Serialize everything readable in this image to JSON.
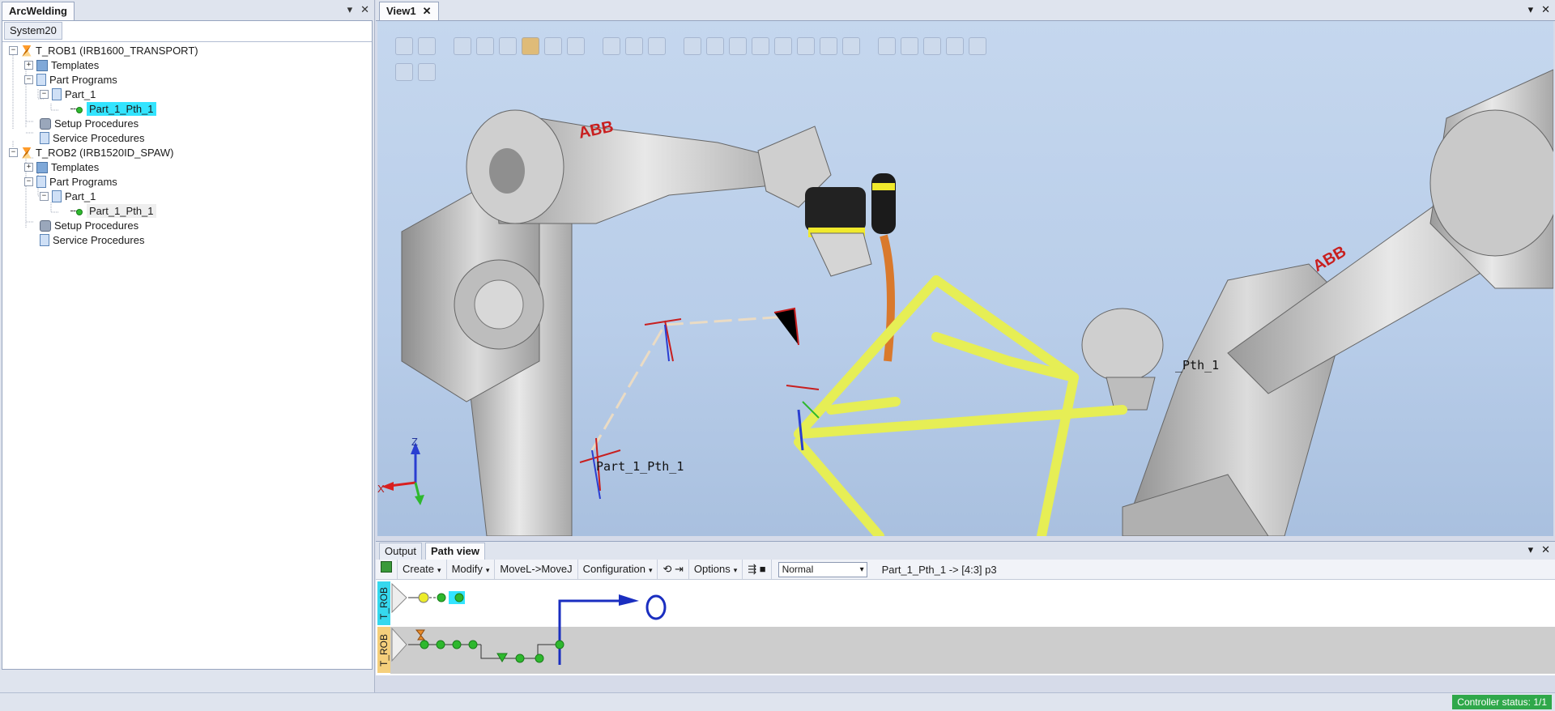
{
  "left_panel": {
    "tab_label": "ArcWelding",
    "sub_tab": "System20",
    "tree": {
      "rob1": "T_ROB1 (IRB1600_TRANSPORT)",
      "rob1_templates": "Templates",
      "rob1_part_programs": "Part Programs",
      "rob1_part": "Part_1",
      "rob1_path": "Part_1_Pth_1",
      "rob1_setup": "Setup Procedures",
      "rob1_service": "Service Procedures",
      "rob2": "T_ROB2 (IRB1520ID_SPAW)",
      "rob2_templates": "Templates",
      "rob2_part_programs": "Part Programs",
      "rob2_part": "Part_1",
      "rob2_path": "Part_1_Pth_1",
      "rob2_setup": "Setup Procedures",
      "rob2_service": "Service Procedures"
    }
  },
  "view": {
    "tab_label": "View1",
    "path_label_main": "Part_1_Pth_1",
    "path_label_right": "_Pth_1",
    "axis": {
      "z": "Z",
      "x": "X"
    },
    "brand_left": "ABB",
    "brand_right": "ABB"
  },
  "bottom": {
    "tab_output": "Output",
    "tab_path_view": "Path view",
    "toolbar": {
      "create": "Create",
      "modify": "Modify",
      "movel_movej": "MoveL->MoveJ",
      "configuration": "Configuration",
      "options": "Options",
      "speed_value": "Normal",
      "path_info": "Part_1_Pth_1 ->   [4:3] p3"
    },
    "lanes": {
      "lane1": "T_ROB",
      "lane2": "T_ROB"
    }
  },
  "status": {
    "controller": "Controller status: 1/1"
  },
  "colors": {
    "selection": "#33e4ff",
    "status_green": "#2fa84a",
    "robot_yellow": "#e6ee55"
  }
}
